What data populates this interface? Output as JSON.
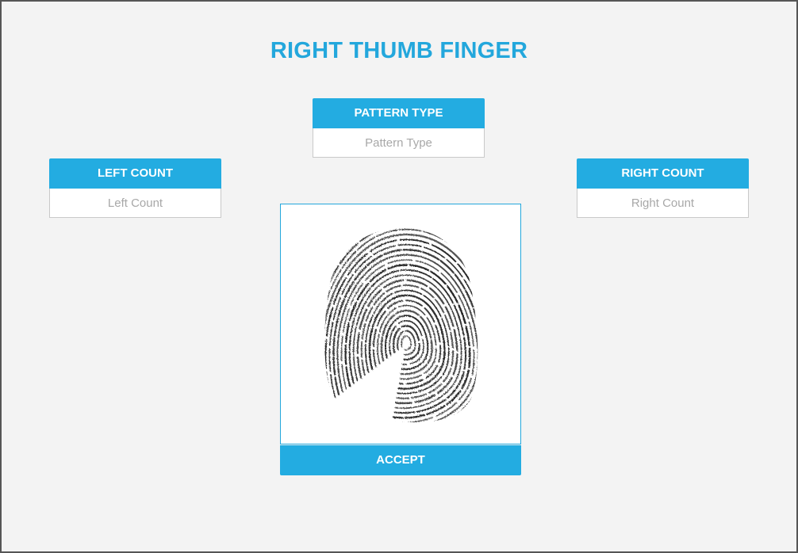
{
  "header": {
    "title": "RIGHT THUMB FINGER"
  },
  "pattern_type": {
    "label": "PATTERN TYPE",
    "placeholder": "Pattern Type",
    "value": ""
  },
  "left_count": {
    "label": "LEFT COUNT",
    "placeholder": "Left Count",
    "value": ""
  },
  "right_count": {
    "label": "RIGHT COUNT",
    "placeholder": "Right Count",
    "value": ""
  },
  "fingerprint": {
    "icon": "fingerprint-image"
  },
  "accept": {
    "label": "ACCEPT"
  },
  "colors": {
    "accent": "#23ace1",
    "title": "#23a7dc",
    "background": "#f3f3f3",
    "border": "#555555"
  }
}
